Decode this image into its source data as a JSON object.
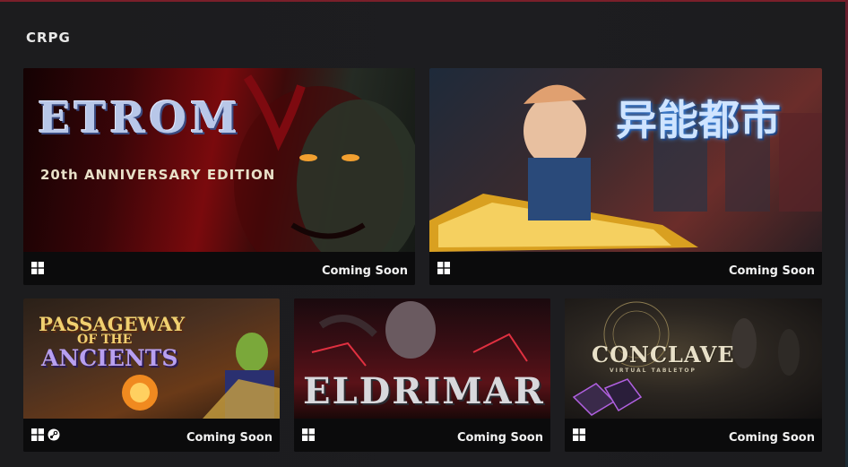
{
  "section": {
    "title": "CRPG"
  },
  "cards": [
    {
      "art_title": "ETROM",
      "art_subtitle": "20th ANNIVERSARY EDITION",
      "status": "Coming Soon",
      "platforms": [
        "windows-icon"
      ]
    },
    {
      "art_title": "异能都市",
      "art_subtitle": "",
      "status": "Coming Soon",
      "platforms": [
        "windows-icon"
      ]
    },
    {
      "art_title": "PASSAGEWAY OF THE ANCIENTS",
      "art_title_line1": "PASSAGEWAY",
      "art_title_line2": "OF THE",
      "art_title_line3": "ANCIENTS",
      "status": "Coming Soon",
      "platforms": [
        "windows-icon",
        "steam-icon"
      ]
    },
    {
      "art_title": "ELDRIMAR",
      "status": "Coming Soon",
      "platforms": [
        "windows-icon"
      ]
    },
    {
      "art_title": "CONCLAVE",
      "art_subtitle": "VIRTUAL TABLETOP",
      "status": "Coming Soon",
      "platforms": [
        "windows-icon"
      ]
    }
  ],
  "colors": {
    "accent_red": "#7a1f2a",
    "background": "#1b1b1d",
    "footer": "#0b0b0c"
  }
}
